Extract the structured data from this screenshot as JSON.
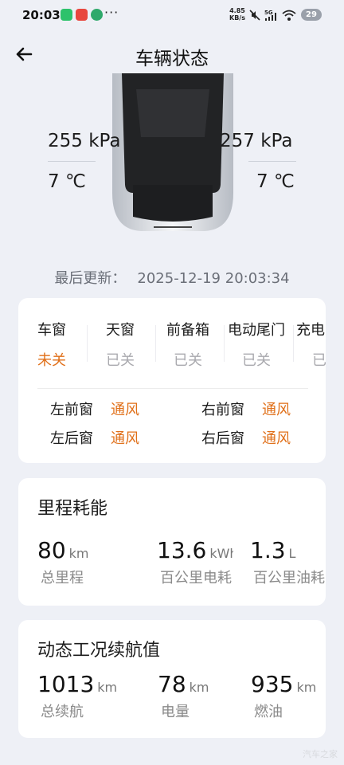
{
  "status_bar": {
    "time": "20:03",
    "net_speed": "4.85",
    "net_speed_unit": "KB/s",
    "battery": "29",
    "app_icons": [
      "chat-app-icon",
      "red-app-icon",
      "mobile-app-icon"
    ],
    "icons": [
      "mute-icon",
      "signal-5g-icon",
      "wifi-icon",
      "battery-icon"
    ]
  },
  "header": {
    "title": "车辆状态"
  },
  "tires": {
    "front_left": {
      "pressure": "255 kPa",
      "temp": "7 ℃"
    },
    "front_right": {
      "pressure": "257 kPa",
      "temp": "7 ℃"
    }
  },
  "updated": {
    "label": "最后更新：",
    "value": "2025-12-19 20:03:34"
  },
  "openings": [
    {
      "name": "车窗",
      "status": "未关",
      "alert": true
    },
    {
      "name": "天窗",
      "status": "已关",
      "alert": false
    },
    {
      "name": "前备箱",
      "status": "已关",
      "alert": false
    },
    {
      "name": "电动尾门",
      "status": "已关",
      "alert": false
    },
    {
      "name": "充电",
      "status": "已",
      "alert": false
    }
  ],
  "windows": {
    "front_left": {
      "label": "左前窗",
      "value": "通风"
    },
    "front_right": {
      "label": "右前窗",
      "value": "通风"
    },
    "rear_left": {
      "label": "左后窗",
      "value": "通风"
    },
    "rear_right": {
      "label": "右后窗",
      "value": "通风"
    }
  },
  "mileage": {
    "title": "里程耗能",
    "items": [
      {
        "value": "80",
        "unit": "km",
        "label": "总里程"
      },
      {
        "value": "13.6",
        "unit": "kWh",
        "label": "百公里电耗"
      },
      {
        "value": "1.3",
        "unit": "L",
        "label": "百公里油耗"
      }
    ]
  },
  "range": {
    "title": "动态工况续航值",
    "items": [
      {
        "value": "1013",
        "unit": "km",
        "label": "总续航"
      },
      {
        "value": "78",
        "unit": "km",
        "label": "电量"
      },
      {
        "value": "935",
        "unit": "km",
        "label": "燃油"
      }
    ]
  },
  "colors": {
    "accent_orange": "#e0701a",
    "background": "#eef0f6",
    "muted": "#8a8a8a"
  },
  "watermark": "汽车之家"
}
